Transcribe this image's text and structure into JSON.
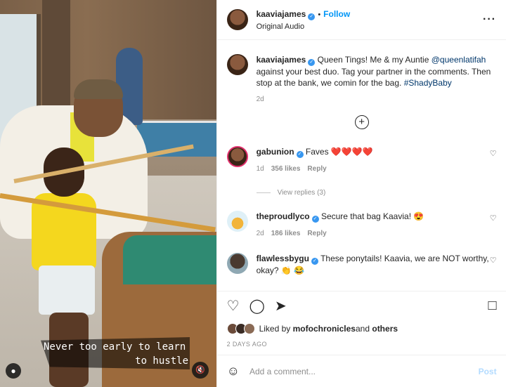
{
  "post": {
    "username": "kaaviajames",
    "follow_label": "Follow",
    "audio": "Original Audio",
    "more_icon": "more-horiz-icon"
  },
  "media": {
    "caption_line1": "Never too early to learn",
    "caption_line2": "to hustle",
    "user_icon": "user-icon",
    "mute_icon": "mute-icon"
  },
  "caption": {
    "username": "kaaviajames",
    "text_before": " Queen Tings! Me & my Auntie ",
    "mention": "@queenlatifah",
    "text_after": " against your best duo. Tag your partner in the comments. Then stop at the bank, we comin for the bag. ",
    "hashtag": "#ShadyBaby",
    "time": "2d"
  },
  "comments": [
    {
      "username": "gabunion",
      "text": "Faves ❤️❤️❤️❤️",
      "time": "1d",
      "likes": "356 likes",
      "reply": "Reply"
    },
    {
      "username": "theproudlyco",
      "text": "Secure that bag Kaavia! 😍",
      "time": "2d",
      "likes": "186 likes",
      "reply": "Reply"
    },
    {
      "username": "flawlessbygu",
      "text": "These ponytails! Kaavia, we are NOT worthy, okay? 👏 😂"
    }
  ],
  "view_replies": "View replies (3)",
  "actions": {
    "like_icon": "heart-icon",
    "comment_icon": "comment-icon",
    "share_icon": "share-icon",
    "save_icon": "bookmark-icon"
  },
  "likes": {
    "prefix": "Liked by ",
    "user": "mofochronicles",
    "middle": " and ",
    "others": "others"
  },
  "date": "2 DAYS AGO",
  "add_comment": {
    "placeholder": "Add a comment...",
    "post_label": "Post"
  },
  "colors": {
    "accent": "#0095f6",
    "verified": "#3897f0",
    "muted": "#8e8e8e"
  }
}
